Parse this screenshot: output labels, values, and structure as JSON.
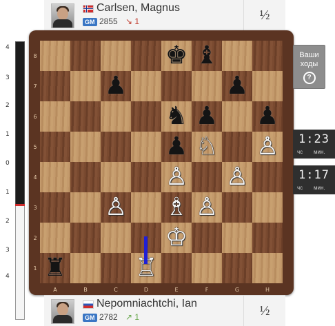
{
  "top_player": {
    "name": "Carlsen, Magnus",
    "title": "GM",
    "rating": "2855",
    "rating_change": "1",
    "score": "½",
    "country": "Norway"
  },
  "bottom_player": {
    "name": "Nepomniachtchi, Ian",
    "title": "GM",
    "rating": "2782",
    "rating_change": "1",
    "score": "½",
    "country": "Russia"
  },
  "eval_bar": {
    "ticks_top": [
      "4",
      "3",
      "2",
      "1",
      "0"
    ],
    "ticks_bottom": [
      "1",
      "2",
      "3",
      "4"
    ],
    "white_share": 0.48
  },
  "your_moves": {
    "line1": "Ваши",
    "line2": "ходы",
    "help": "?"
  },
  "clocks": [
    {
      "time": "1:23",
      "hours_label": "чс",
      "minutes_label": "мин."
    },
    {
      "time": "1:17",
      "hours_label": "чс",
      "minutes_label": "мин."
    }
  ],
  "board": {
    "files": [
      "A",
      "B",
      "C",
      "D",
      "E",
      "F",
      "G",
      "H"
    ],
    "ranks": [
      "8",
      "7",
      "6",
      "5",
      "4",
      "3",
      "2",
      "1"
    ],
    "position": [
      {
        "sq": "e8",
        "piece": "♚",
        "color": "b"
      },
      {
        "sq": "f8",
        "piece": "♝",
        "color": "b"
      },
      {
        "sq": "c7",
        "piece": "♟",
        "color": "b"
      },
      {
        "sq": "g7",
        "piece": "♟",
        "color": "b"
      },
      {
        "sq": "e6",
        "piece": "♞",
        "color": "b"
      },
      {
        "sq": "f6",
        "piece": "♟",
        "color": "b"
      },
      {
        "sq": "h6",
        "piece": "♟",
        "color": "b"
      },
      {
        "sq": "e5",
        "piece": "♟",
        "color": "b"
      },
      {
        "sq": "f5",
        "piece": "♘",
        "color": "w"
      },
      {
        "sq": "h5",
        "piece": "♙",
        "color": "w"
      },
      {
        "sq": "e4",
        "piece": "♙",
        "color": "w"
      },
      {
        "sq": "g4",
        "piece": "♙",
        "color": "w"
      },
      {
        "sq": "c3",
        "piece": "♙",
        "color": "w"
      },
      {
        "sq": "e3",
        "piece": "♗",
        "color": "w"
      },
      {
        "sq": "f3",
        "piece": "♙",
        "color": "w"
      },
      {
        "sq": "e2",
        "piece": "♔",
        "color": "w"
      },
      {
        "sq": "a1",
        "piece": "♜",
        "color": "b"
      },
      {
        "sq": "d1",
        "piece": "♖",
        "color": "w"
      }
    ],
    "last_move_arrow": {
      "from": "d2",
      "to": "d1",
      "color": "#1f1fd6"
    }
  },
  "colors": {
    "frame": "#5b3422",
    "light_square": "#c49a6c",
    "dark_square": "#7a4a30",
    "gm_badge": "#3a76c4"
  }
}
